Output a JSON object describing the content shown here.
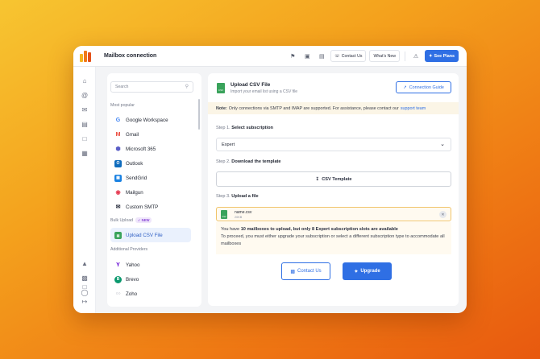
{
  "app": {
    "title": "Mailbox connection"
  },
  "toolbar": {
    "contact_us": "Contact Us",
    "whats_new": "What's New",
    "see_plans": "See Plans"
  },
  "sidebar": {
    "search_placeholder": "Search",
    "most_popular_label": "Most popular",
    "popular": [
      {
        "label": "Google Workspace",
        "icon": "google-icon"
      },
      {
        "label": "Gmail",
        "icon": "gmail-icon"
      },
      {
        "label": "Microsoft 365",
        "icon": "microsoft-icon"
      },
      {
        "label": "Outlook",
        "icon": "outlook-icon"
      },
      {
        "label": "SendGrid",
        "icon": "sendgrid-icon"
      },
      {
        "label": "Mailgun",
        "icon": "mailgun-icon"
      },
      {
        "label": "Custom SMTP",
        "icon": "envelope-icon"
      }
    ],
    "bulk_upload_label": "Bulk Upload",
    "new_badge": "NEW",
    "bulk": [
      {
        "label": "Upload CSV File",
        "icon": "csv-file-icon",
        "active": true
      }
    ],
    "additional_label": "Additional Providers",
    "additional": [
      {
        "label": "Yahoo",
        "icon": "yahoo-icon"
      },
      {
        "label": "Brevo",
        "icon": "brevo-icon"
      },
      {
        "label": "Zoho",
        "icon": "zoho-icon"
      }
    ]
  },
  "main": {
    "title": "Upload CSV File",
    "subtitle": "Import your email list using a CSV file",
    "guide_button": "Connection Guide",
    "note_label": "Note:",
    "note_text": "Only connections via SMTP and IMAP are supported. For assistance, please contact our",
    "note_link": "support team",
    "step1_prefix": "Step 1.",
    "step1_title": "Select subscription",
    "subscription_value": "Expert",
    "step2_prefix": "Step 2.",
    "step2_title": "Download the template",
    "template_button": "CSV Template",
    "step3_prefix": "Step 3.",
    "step3_title": "Upload a file",
    "file_name": "name.csv",
    "file_size": "20KB",
    "warning_pre": "You have",
    "warning_bold1": "10 mailboxes to upload, but only 8 Expert subscription slots are available",
    "warning_line2": "To proceed, you must either upgrade your subscription or select a different subscription type to accommodate all mailboxes",
    "contact_button": "Contact Us",
    "upgrade_button": "Upgrade"
  },
  "colors": {
    "accent": "#2f6fe4",
    "warning_bg": "#fffaf0",
    "note_bg": "#fbf5e6"
  }
}
